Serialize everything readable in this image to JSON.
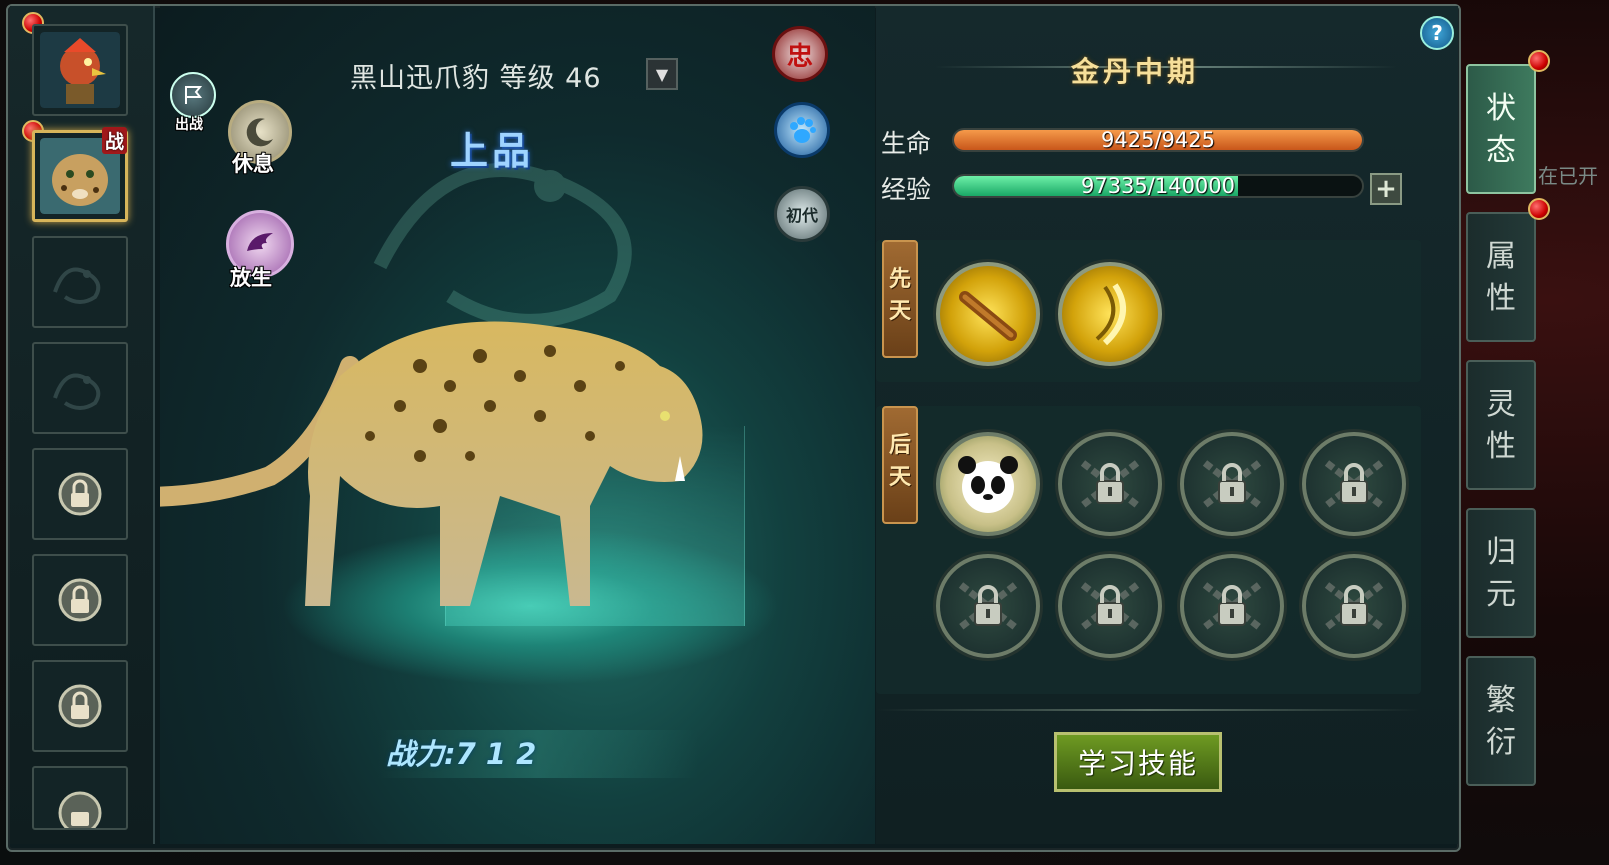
{
  "pet": {
    "name_level": "黑山迅爪豹 等级 46",
    "grade": "上品",
    "power": "战力:7 1 2",
    "status_badge": "战"
  },
  "actions": {
    "deploy_label": "出战",
    "rest_label": "休息",
    "release_label": "放生"
  },
  "side_icons": {
    "loyalty": "忠",
    "generation": "初代"
  },
  "stats": {
    "realm": "金丹中期",
    "hp_label": "生命",
    "hp_text": "9425/9425",
    "hp_current": 9425,
    "hp_max": 9425,
    "exp_label": "经验",
    "exp_text": "97335/140000",
    "exp_current": 97335,
    "exp_max": 140000,
    "plus": "+",
    "help": "?"
  },
  "skills": {
    "innate_tag": "先天",
    "acquired_tag": "后天",
    "innate": [
      "golden-staff-icon",
      "golden-claw-icon"
    ],
    "acquired": [
      "panda-icon",
      "lock-icon",
      "lock-icon",
      "lock-icon",
      "lock-icon",
      "lock-icon",
      "lock-icon",
      "lock-icon"
    ],
    "learn_label": "学习技能"
  },
  "tabs": [
    "状态",
    "属性",
    "灵性",
    "归元",
    "繁衍"
  ],
  "outside": {
    "hint": "在已开"
  },
  "colors": {
    "hp": "#e2782a",
    "exp": "#3ad08a",
    "gold_text": "#f6df9a",
    "grade": "#9fd4ff"
  }
}
